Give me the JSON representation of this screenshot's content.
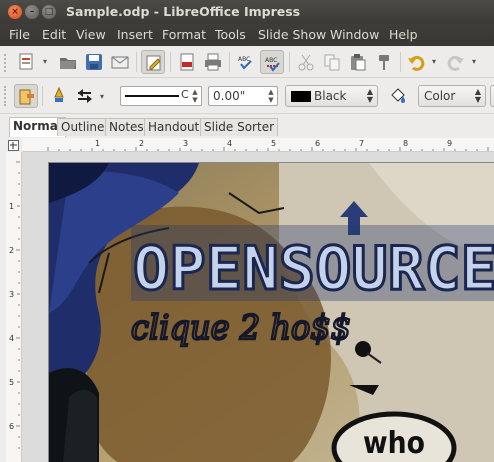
{
  "window": {
    "title": "Sample.odp - LibreOffice Impress"
  },
  "menu": [
    "File",
    "Edit",
    "View",
    "Insert",
    "Format",
    "Tools",
    "Slide Show",
    "Window",
    "Help"
  ],
  "toolbar2": {
    "line_width_value": "0.00\"",
    "line_color_label": "Black",
    "area_style_label": "Color"
  },
  "view_tabs": [
    "Normal",
    "Outline",
    "Notes",
    "Handout",
    "Slide Sorter"
  ],
  "active_tab": "Normal",
  "ruler": {
    "horizontal": [
      "1",
      "2",
      "3",
      "4",
      "5",
      "6",
      "7",
      "8",
      "9"
    ],
    "vertical": [
      "1",
      "2",
      "3",
      "4",
      "5",
      "6"
    ]
  },
  "slide": {
    "graffiti_main": "OPENSOURCE",
    "graffiti_script": "clique 2 ho$$",
    "graffiti_circle": "who"
  },
  "colors": {
    "titlebar": "#3c3b37",
    "title_text": "#dfdbd2",
    "close_button": "#e05a22",
    "toolbar_bg": "#edecea"
  }
}
